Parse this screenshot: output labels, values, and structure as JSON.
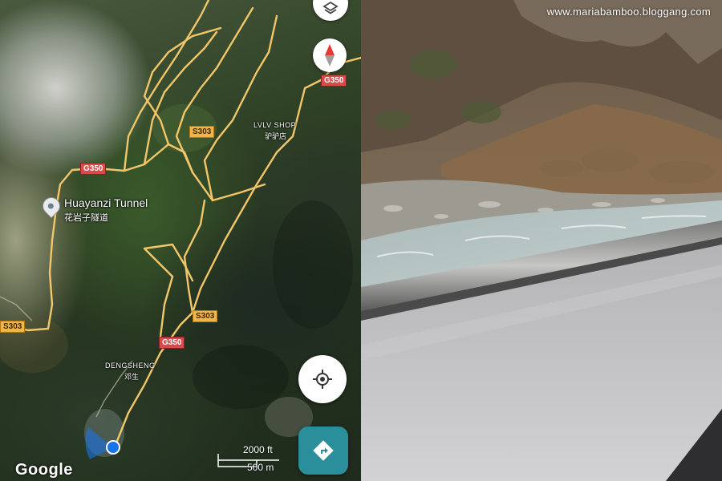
{
  "map": {
    "road_shields": {
      "g350_top": "G350",
      "s303_upper": "S303",
      "g350_left": "G350",
      "s303_left": "S303",
      "s303_mid": "S303",
      "g350_lower": "G350"
    },
    "places": {
      "tunnel_name": "Huayanzi Tunnel",
      "tunnel_name_cn": "花岩子隧道",
      "shop_name": "LVLV SHOP",
      "shop_name_cn": "驴驴店",
      "village_name": "DENGSHENG",
      "village_name_cn": "邓生"
    },
    "scale": {
      "imperial": "2000 ft",
      "metric": "500 m"
    },
    "attribution": "Google",
    "icons": {
      "layers": "layers-icon",
      "compass": "compass-icon",
      "my_location": "crosshair-icon",
      "directions": "directions-arrow-icon",
      "place_pin": "map-pin-icon",
      "user_location": "blue-dot-icon"
    },
    "colors": {
      "road": "#f3c66a",
      "highway_shield": "#d94a4a",
      "state_shield": "#f3b54a",
      "directions_button": "#2a8f9a",
      "location_dot": "#1a73e8"
    }
  },
  "photo": {
    "watermark": "www.mariabamboo.bloggang.com"
  }
}
